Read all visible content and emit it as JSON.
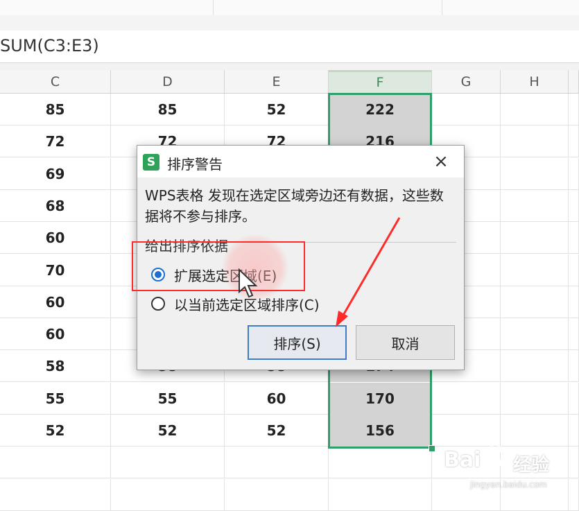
{
  "formula_bar": {
    "text": "SUM(C3:E3)"
  },
  "columns": [
    "C",
    "D",
    "E",
    "F",
    "G",
    "H"
  ],
  "rows": [
    {
      "C": "85",
      "D": "85",
      "E": "52",
      "F": "222"
    },
    {
      "C": "72",
      "D": "72",
      "E": "72",
      "F": "216"
    },
    {
      "C": "69",
      "D": "",
      "E": "",
      "F": ""
    },
    {
      "C": "68",
      "D": "",
      "E": "",
      "F": ""
    },
    {
      "C": "60",
      "D": "",
      "E": "",
      "F": ""
    },
    {
      "C": "70",
      "D": "",
      "E": "",
      "F": ""
    },
    {
      "C": "60",
      "D": "",
      "E": "",
      "F": ""
    },
    {
      "C": "60",
      "D": "",
      "E": "",
      "F": ""
    },
    {
      "C": "58",
      "D": "58",
      "E": "58",
      "F": "174"
    },
    {
      "C": "55",
      "D": "55",
      "E": "60",
      "F": "170"
    },
    {
      "C": "52",
      "D": "52",
      "E": "52",
      "F": "156"
    }
  ],
  "dialog": {
    "logo": "S",
    "title": "排序警告",
    "close_icon": "×",
    "message": "WPS表格 发现在选定区域旁边还有数据，这些数据将不参与排序。",
    "group_label": "给出排序依据",
    "options": [
      {
        "label": "扩展选定区域(E)",
        "selected": true
      },
      {
        "label": "以当前选定区域排序(C)",
        "selected": false
      }
    ],
    "sort_button": "排序(S)",
    "cancel_button": "取消"
  },
  "watermark": {
    "brand": "Bai",
    "brand_cn": "经验",
    "url": "jingyan.baidu.com"
  },
  "colors": {
    "selection_border": "#2e9e6a",
    "annotation_red": "#ff2b2b",
    "radio_blue": "#1a6fd0"
  }
}
